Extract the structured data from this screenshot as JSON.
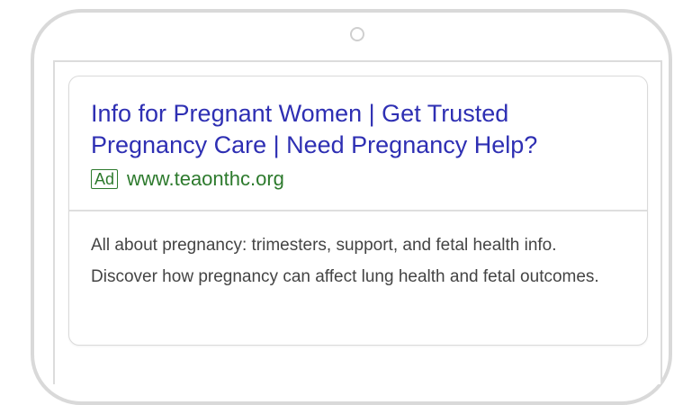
{
  "ad": {
    "headline": "Info for Pregnant Women | Get Trusted Pregnancy Care | Need Pregnancy Help?",
    "badge": "Ad",
    "display_url": "www.teaonthc.org",
    "description": "All about pregnancy: trimesters, support, and fetal health info. Discover how pregnancy can affect lung health and fetal outcomes."
  },
  "colors": {
    "headline": "#2e2fb3",
    "url": "#2d7a2d",
    "description": "#444444",
    "frame": "#d9d9d9"
  }
}
